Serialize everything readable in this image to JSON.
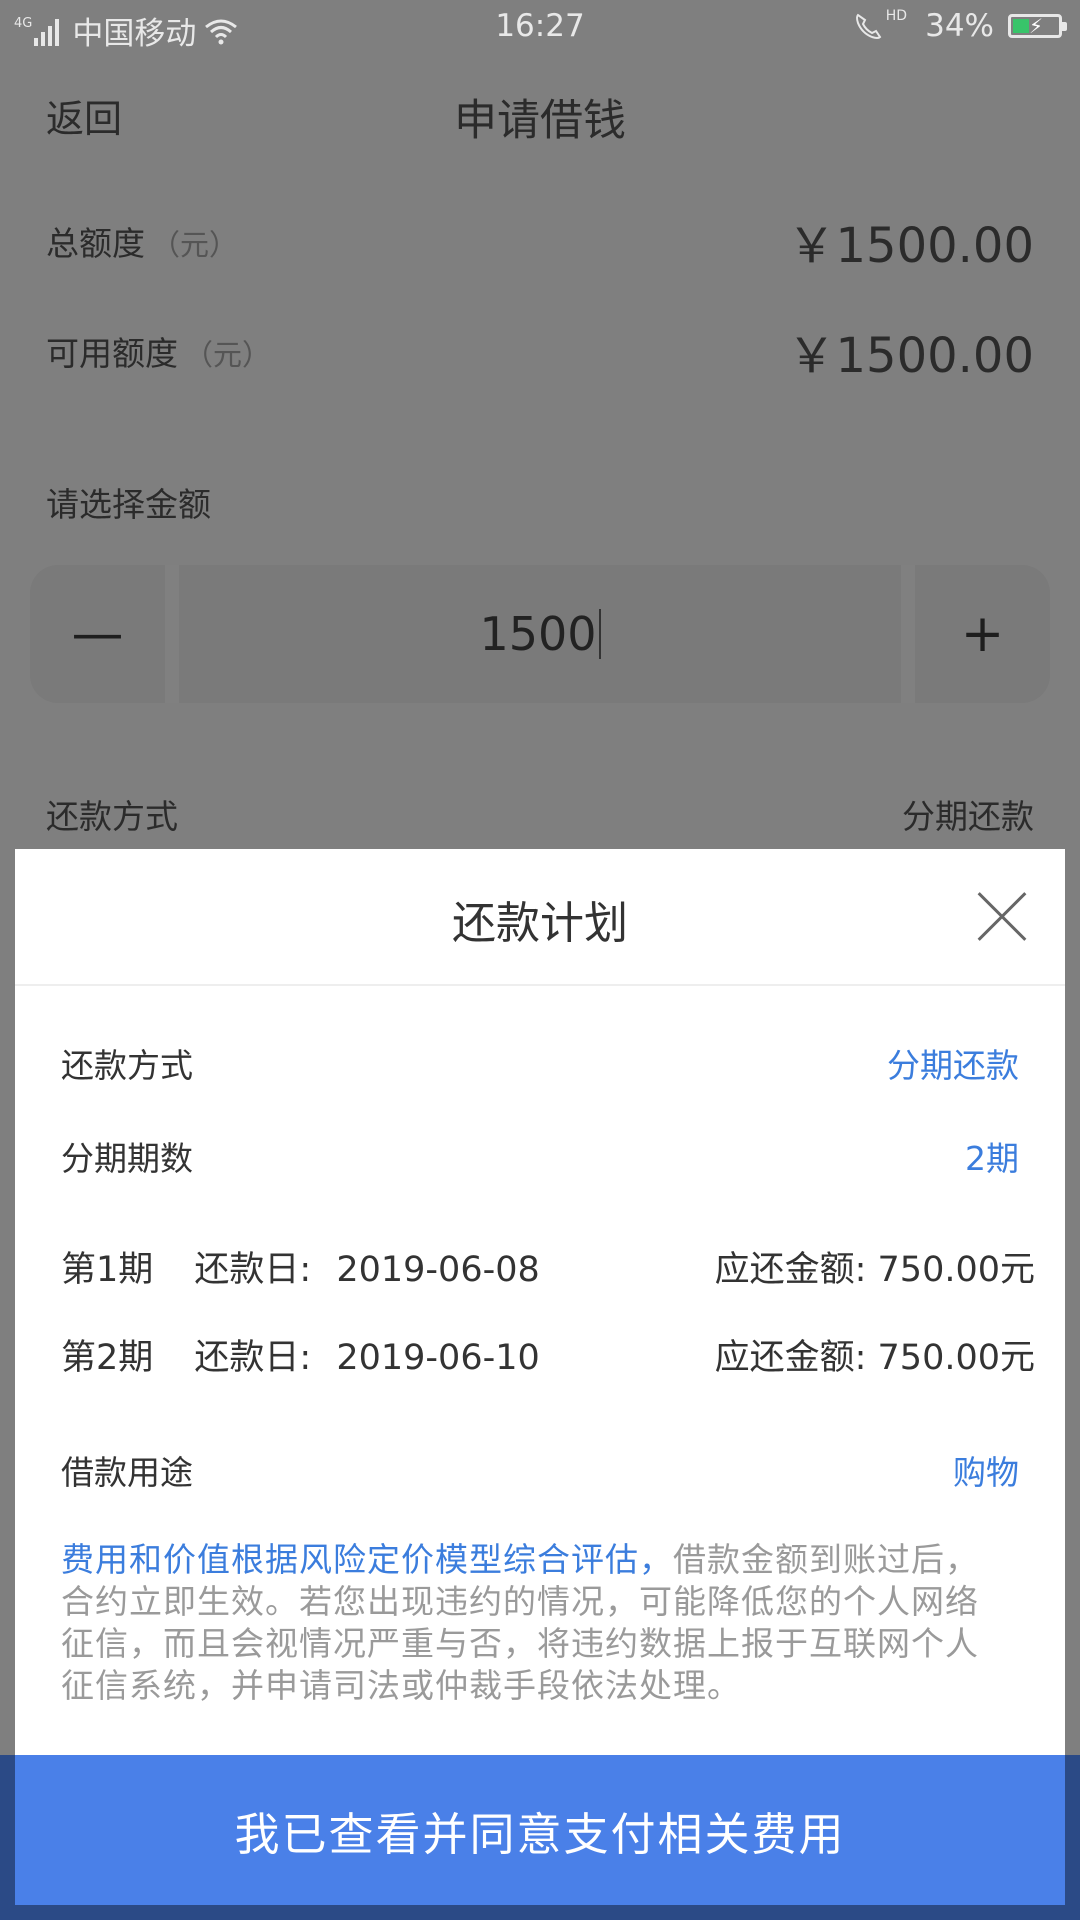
{
  "status_bar": {
    "network": "4G",
    "carrier": "中国移动",
    "time": "16:27",
    "hd": "HD",
    "battery_percent": "34%",
    "battery_level": 0.34,
    "battery_color": "#38c46a"
  },
  "navbar": {
    "back_label": "返回",
    "title": "申请借钱"
  },
  "quota": {
    "total_label": "总额度",
    "total_unit": "（元）",
    "total_value": "￥1500.00",
    "available_label": "可用额度",
    "available_unit": "（元）",
    "available_value": "￥1500.00"
  },
  "amount": {
    "label": "请选择金额",
    "minus": "—",
    "value": "1500",
    "plus": "+"
  },
  "repayment_background": {
    "label": "还款方式",
    "value": "分期还款"
  },
  "modal": {
    "title": "还款计划",
    "method_label": "还款方式",
    "method_value": "分期还款",
    "periods_label": "分期期数",
    "periods_value": "2期",
    "plan": [
      {
        "period": "第1期",
        "date_label": "还款日:",
        "date": "2019-06-08",
        "amount_label": "应还金额:",
        "amount": "750.00元"
      },
      {
        "period": "第2期",
        "date_label": "还款日:",
        "date": "2019-06-10",
        "amount_label": "应还金额:",
        "amount": "750.00元"
      }
    ],
    "purpose_label": "借款用途",
    "purpose_value": "购物",
    "notice_highlight": "费用和价值根据风险定价模型综合评估，",
    "notice_rest": "借款金额到账过后，合约立即生效。若您出现违约的情况，可能降低您的个人网络征信，而且会视情况严重与否，将违约数据上报于互联网个人征信系统，并申请司法或仲裁手段依法处理。"
  },
  "agree_button": "我已查看并同意支付相关费用",
  "colors": {
    "accent": "#3b7ddd",
    "button": "#4a80e8",
    "overlay": "#7f7f7f"
  }
}
